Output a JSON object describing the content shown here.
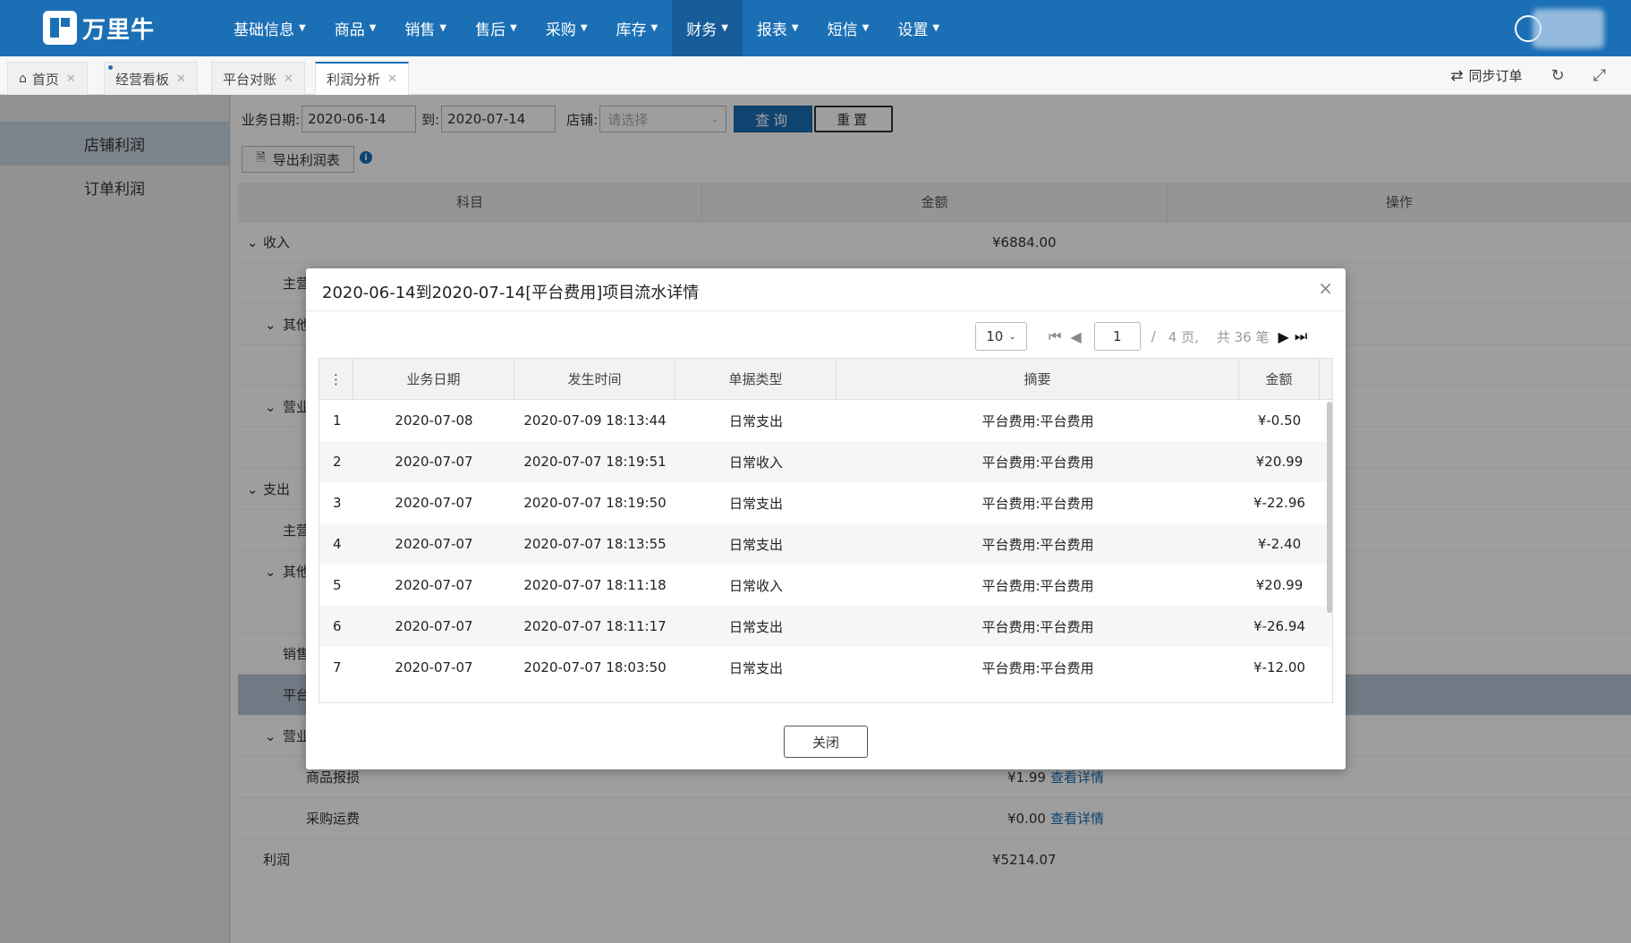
{
  "app": {
    "logo_text": "万里牛"
  },
  "nav": {
    "items": [
      {
        "label": "基础信息"
      },
      {
        "label": "商品"
      },
      {
        "label": "销售"
      },
      {
        "label": "售后"
      },
      {
        "label": "采购"
      },
      {
        "label": "库存"
      },
      {
        "label": "财务"
      },
      {
        "label": "报表"
      },
      {
        "label": "短信"
      },
      {
        "label": "设置"
      }
    ],
    "active": "财务"
  },
  "tabs": [
    {
      "label": "首页"
    },
    {
      "label": "经营看板"
    },
    {
      "label": "平台对账"
    },
    {
      "label": "利润分析"
    }
  ],
  "tab_actions": {
    "sync_label": "同步订单"
  },
  "sidemenu": {
    "items": [
      {
        "label": "店铺利润"
      },
      {
        "label": "订单利润"
      }
    ]
  },
  "filters": {
    "date_label": "业务日期:",
    "date_from": "2020-06-14",
    "to_label": "到:",
    "date_to": "2020-07-14",
    "shop_label": "店铺:",
    "shop_placeholder": "请选择",
    "query_label": "查询",
    "reset_label": "重置",
    "export_label": "导出利润表"
  },
  "grid": {
    "headers": [
      "科目",
      "金额",
      "操作"
    ],
    "rows": [
      {
        "name": "收入",
        "amount": "¥6884.00"
      },
      {
        "name": "主营"
      },
      {
        "name": "其他"
      },
      {
        "name": ""
      },
      {
        "name": "营业"
      },
      {
        "name": ""
      },
      {
        "name": "支出"
      },
      {
        "name": "主营"
      },
      {
        "name": "其他"
      },
      {
        "name": ""
      },
      {
        "name": "销售"
      },
      {
        "name": "平台"
      },
      {
        "name": "营业"
      },
      {
        "name": "商品报损",
        "amount": "¥1.99",
        "action": "查看详情"
      },
      {
        "name": "采购运费",
        "amount": "¥0.00",
        "action": "查看详情"
      },
      {
        "name": "利润",
        "amount": "¥5214.07"
      }
    ]
  },
  "modal": {
    "title": "2020-06-14到2020-07-14[平台费用]项目流水详情",
    "close_label": "关闭",
    "pager": {
      "page_size": "10",
      "page": "1",
      "sep": "/",
      "pages_text": "4 页,",
      "total_text": "共 36 笔"
    },
    "columns": [
      "业务日期",
      "发生时间",
      "单据类型",
      "摘要",
      "金额"
    ],
    "rows": [
      {
        "no": "1",
        "date": "2020-07-08",
        "time": "2020-07-09 18:13:44",
        "type": "日常支出",
        "summary": "平台费用:平台费用",
        "amount": "¥-0.50"
      },
      {
        "no": "2",
        "date": "2020-07-07",
        "time": "2020-07-07 18:19:51",
        "type": "日常收入",
        "summary": "平台费用:平台费用",
        "amount": "¥20.99"
      },
      {
        "no": "3",
        "date": "2020-07-07",
        "time": "2020-07-07 18:19:50",
        "type": "日常支出",
        "summary": "平台费用:平台费用",
        "amount": "¥-22.96"
      },
      {
        "no": "4",
        "date": "2020-07-07",
        "time": "2020-07-07 18:13:55",
        "type": "日常支出",
        "summary": "平台费用:平台费用",
        "amount": "¥-2.40"
      },
      {
        "no": "5",
        "date": "2020-07-07",
        "time": "2020-07-07 18:11:18",
        "type": "日常收入",
        "summary": "平台费用:平台费用",
        "amount": "¥20.99"
      },
      {
        "no": "6",
        "date": "2020-07-07",
        "time": "2020-07-07 18:11:17",
        "type": "日常支出",
        "summary": "平台费用:平台费用",
        "amount": "¥-26.94"
      },
      {
        "no": "7",
        "date": "2020-07-07",
        "time": "2020-07-07 18:03:50",
        "type": "日常支出",
        "summary": "平台费用:平台费用",
        "amount": "¥-12.00"
      }
    ]
  }
}
